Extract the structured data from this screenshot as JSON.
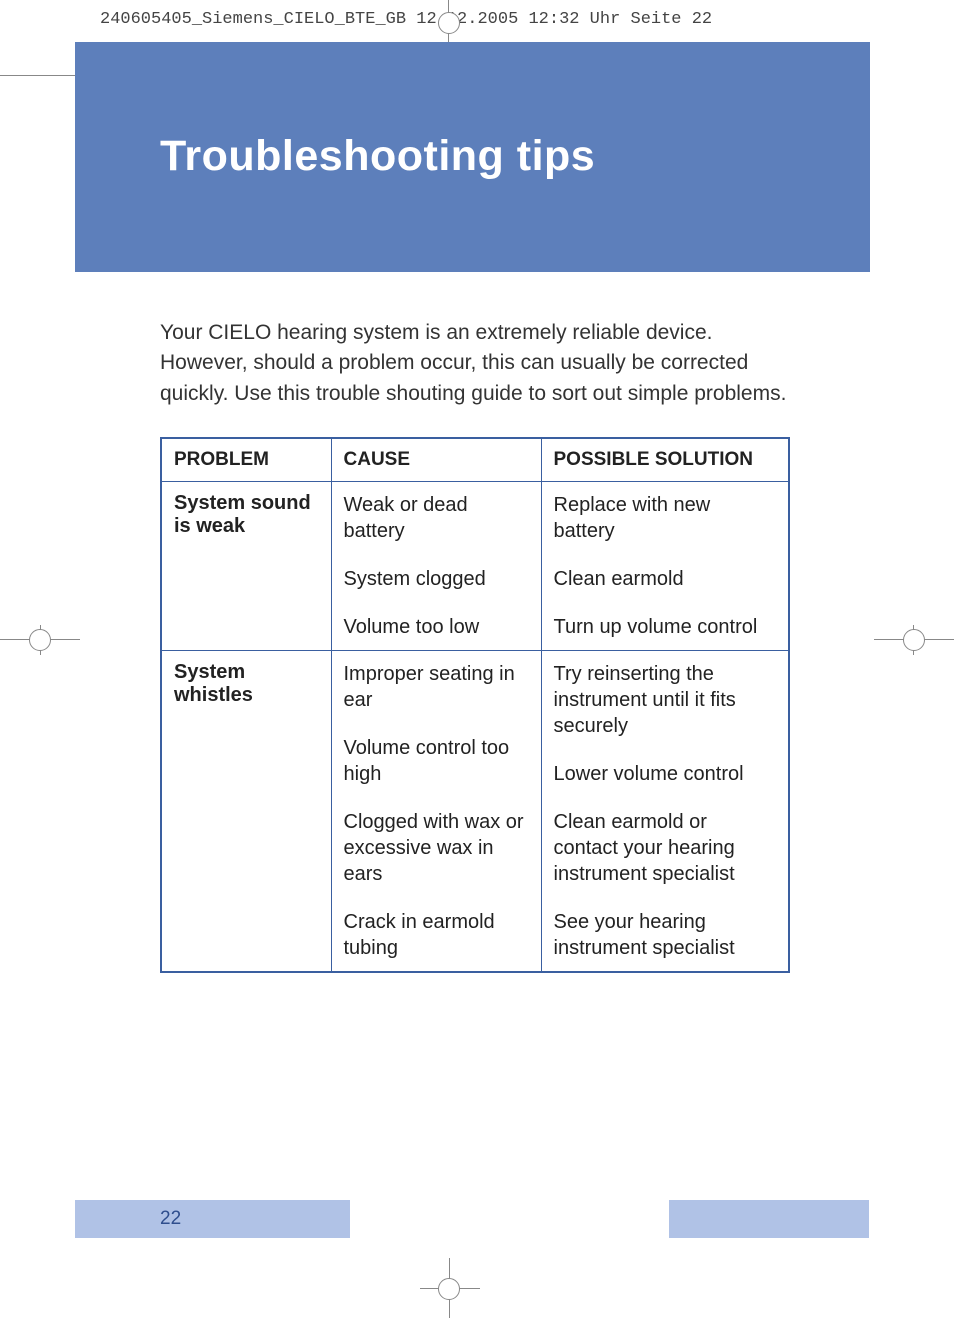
{
  "crop_header": "240605405_Siemens_CIELO_BTE_GB  12.12.2005  12:32 Uhr  Seite 22",
  "title": "Troubleshooting tips",
  "intro": "Your CIELO hearing system is an extremely reliable device. However, should a problem occur, this can usually be corrected quickly. Use this trouble shouting guide to sort out simple problems.",
  "table": {
    "headers": {
      "problem": "PROBLEM",
      "cause": "CAUSE",
      "solution": "POSSIBLE SOLUTION"
    },
    "rows": [
      {
        "problem": "System sound is weak",
        "causes": [
          "Weak or dead battery",
          "System  clogged",
          "Volume too low"
        ],
        "solutions": [
          "Replace with new battery",
          "Clean earmold",
          "Turn up volume control"
        ]
      },
      {
        "problem": "System whistles",
        "causes": [
          "Improper seating in ear",
          "Volume control too high",
          "Clogged with wax or excessive wax in ears",
          "Crack in earmold tubing"
        ],
        "solutions": [
          "Try reinserting the instrument until it fits securely",
          "Lower volume control",
          "Clean earmold or contact your hearing instrument specialist",
          "See your hearing instrument specialist"
        ]
      }
    ]
  },
  "page_number": "22"
}
